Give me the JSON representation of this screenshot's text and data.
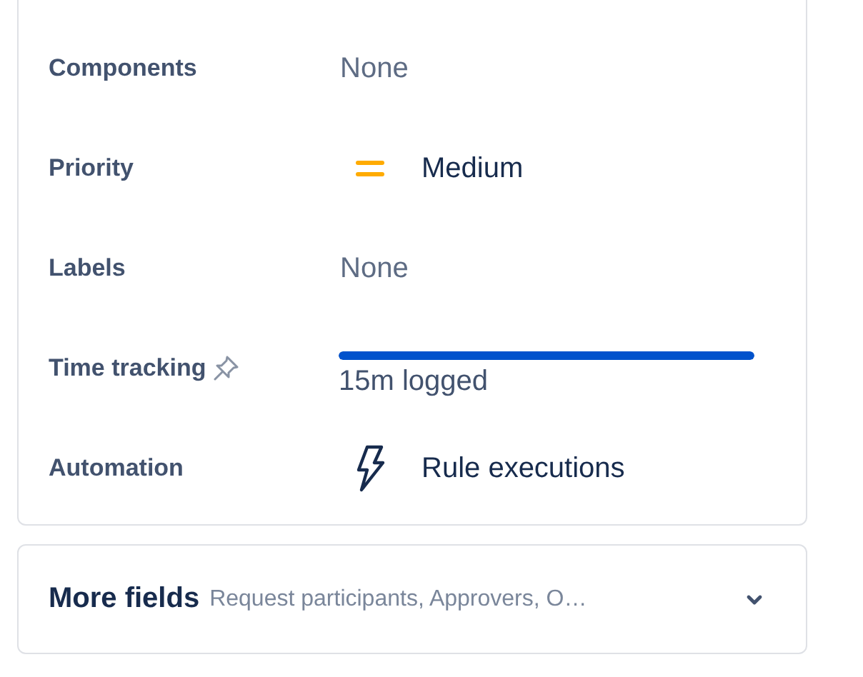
{
  "fields": [
    {
      "label": "Components",
      "kind": "text",
      "value": "None"
    },
    {
      "label": "Priority",
      "kind": "priority",
      "value": "Medium"
    },
    {
      "label": "Labels",
      "kind": "text",
      "value": "None"
    },
    {
      "label": "Time tracking",
      "kind": "time",
      "pinned": true,
      "level": 1,
      "value": "15m logged"
    },
    {
      "label": "Automation",
      "kind": "automation",
      "value": "Rule executions"
    }
  ],
  "more_fields": {
    "title": "More fields",
    "summary": "Request participants, Approvers, O…",
    "expanded": false
  }
}
